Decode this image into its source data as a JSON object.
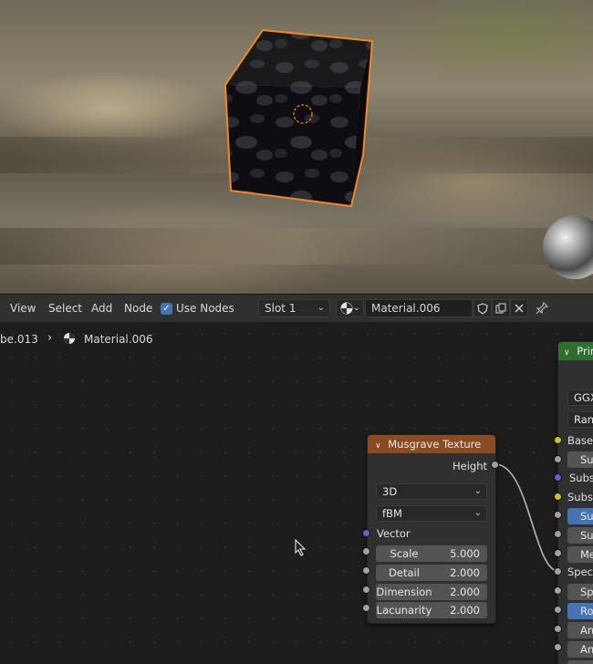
{
  "header": {
    "menu": [
      "View",
      "Select",
      "Add",
      "Node"
    ],
    "use_nodes_label": "Use Nodes",
    "slot": "Slot 1",
    "material_name": "Material.006"
  },
  "breadcrumb": {
    "object": "be.013",
    "material": "Material.006"
  },
  "musgrave_node": {
    "title": "Musgrave Texture",
    "output": "Height",
    "dimensions": "3D",
    "type": "fBM",
    "vector_label": "Vector",
    "fields": [
      {
        "label": "Scale",
        "value": "5.000"
      },
      {
        "label": "Detail",
        "value": "2.000"
      },
      {
        "label": "Dimension",
        "value": "2.000"
      },
      {
        "label": "Lacunarity",
        "value": "2.000"
      }
    ]
  },
  "principled_node": {
    "title": "Prin",
    "distribution": "GGX",
    "sss_method": "Rand",
    "rows": [
      "Base C",
      "Su",
      "Subs",
      "Subsu",
      "Su",
      "Su",
      "Me",
      "Specu",
      "Sp",
      "Ro",
      "An",
      "An",
      "Sh"
    ]
  },
  "colors": {
    "selection_outline": "#f0882a",
    "musgrave_header": "#8a4a22",
    "principled_header": "#2f6e2f",
    "accent_blue": "#4772b3"
  }
}
